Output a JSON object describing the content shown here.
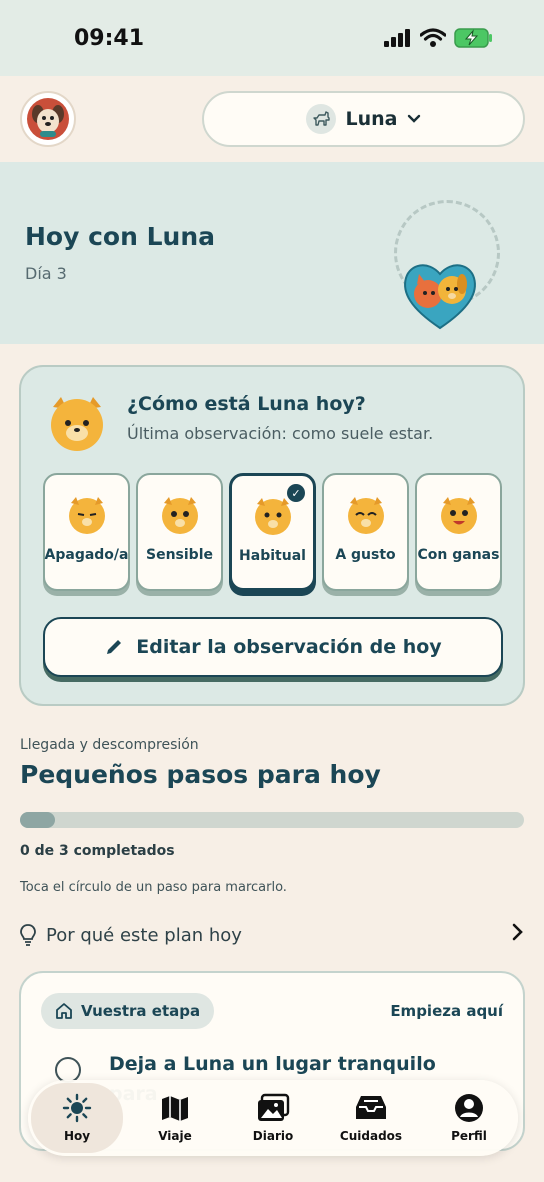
{
  "status_bar": {
    "time": "09:41"
  },
  "header": {
    "pet_name": "Luna"
  },
  "hero": {
    "title": "Hoy con Luna",
    "day": "Día 3"
  },
  "mood": {
    "question": "¿Cómo está Luna hoy?",
    "last_observation": "Última observación: como suele estar.",
    "selected": "Habitual",
    "options": [
      {
        "label": "Apagado/a",
        "face": "sleepy"
      },
      {
        "label": "Sensible",
        "face": "worried"
      },
      {
        "label": "Habitual",
        "face": "neutral"
      },
      {
        "label": "A gusto",
        "face": "content"
      },
      {
        "label": "Con ganas",
        "face": "excited"
      }
    ],
    "edit_label": "Editar la observación de hoy"
  },
  "plan": {
    "stage": "Llegada y descompresión",
    "title": "Pequeños pasos para hoy",
    "progress_fraction": 0.07,
    "progress_text": "0 de 3 completados",
    "hint": "Toca el círculo de un paso para marcarlo.",
    "why_label": "Por qué este plan hoy"
  },
  "step_card": {
    "chip_label": "Vuestra etapa",
    "start_label": "Empieza aquí",
    "step_text": "Deja a Luna un lugar tranquilo para"
  },
  "tabs": [
    {
      "label": "Hoy",
      "icon": "sun-icon",
      "active": true
    },
    {
      "label": "Viaje",
      "icon": "map-icon",
      "active": false
    },
    {
      "label": "Diario",
      "icon": "photos-icon",
      "active": false
    },
    {
      "label": "Cuidados",
      "icon": "inbox-icon",
      "active": false
    },
    {
      "label": "Perfil",
      "icon": "person-icon",
      "active": false
    }
  ],
  "colors": {
    "accent": "#1b4655",
    "hero_bg": "#dce9e5",
    "page_bg": "#f7efe6"
  }
}
